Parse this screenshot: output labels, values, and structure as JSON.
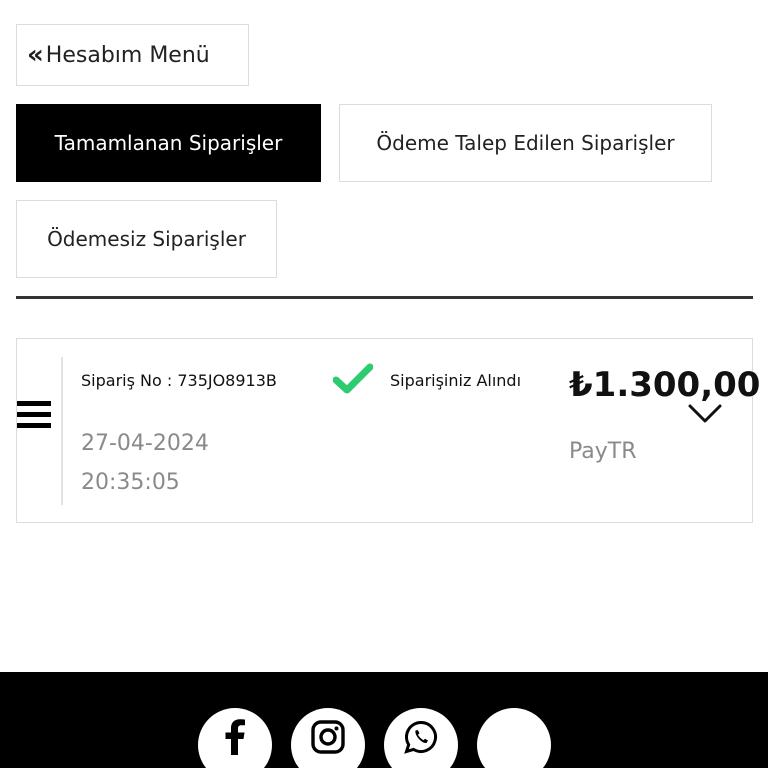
{
  "menu": {
    "back_label": "Hesabım Menü",
    "back_icon": "double-chevron-left-icon"
  },
  "tabs": [
    {
      "label": "Tamamlanan Siparişler",
      "active": true
    },
    {
      "label": "Ödeme Talep Edilen Siparişler",
      "active": false
    },
    {
      "label": "Ödemesiz Siparişler",
      "active": false
    }
  ],
  "order": {
    "number_label": "Sipariş No : 735JO8913B",
    "date": "27-04-2024",
    "time": "20:35:05",
    "status": "Siparişiniz Alındı",
    "status_color": "#2ecc71",
    "price": "₺1.300,00",
    "payment_method": "PayTR"
  },
  "footer": {
    "social_icons": [
      "facebook-icon",
      "instagram-icon",
      "whatsapp-icon",
      "blank-icon"
    ]
  }
}
